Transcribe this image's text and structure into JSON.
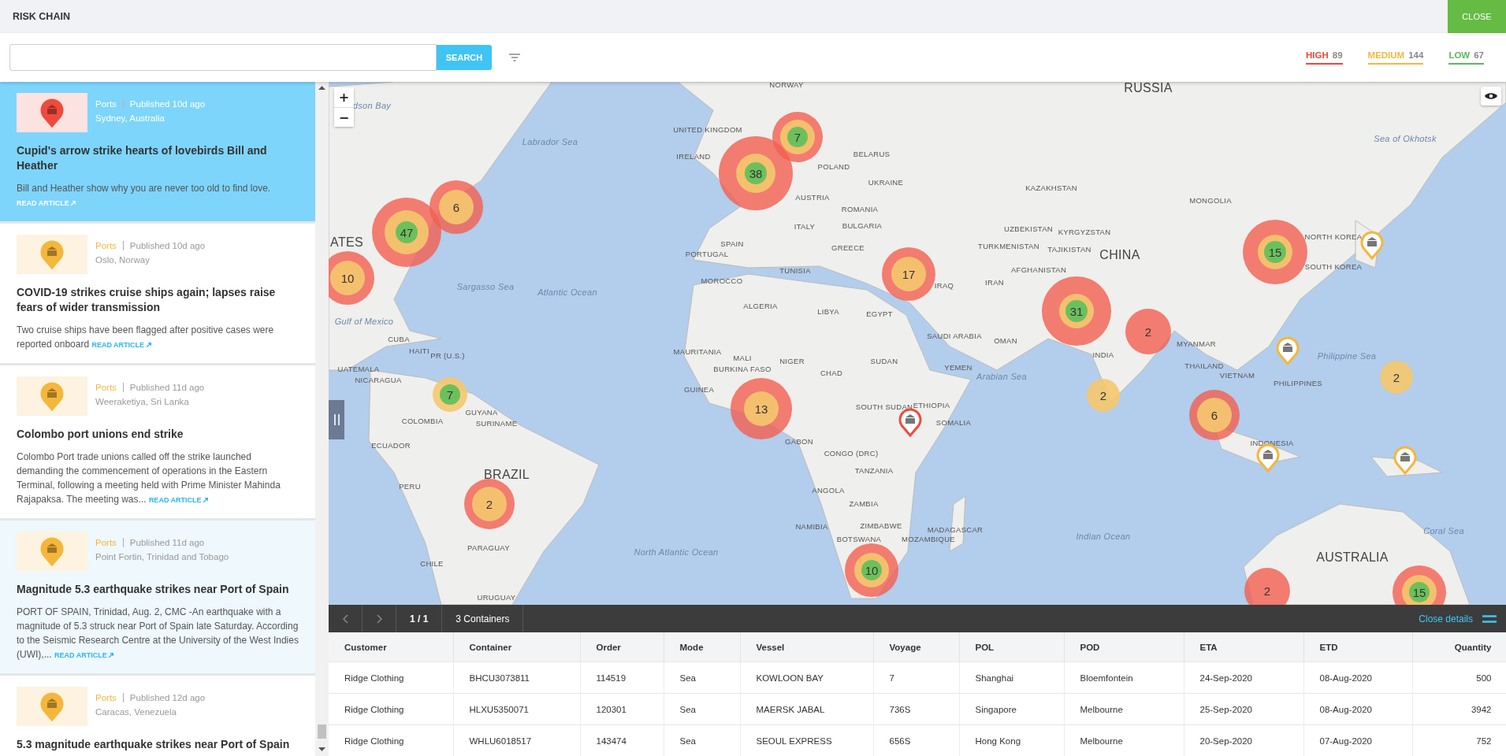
{
  "header": {
    "title": "RISK CHAIN",
    "close_button": "CLOSE"
  },
  "toolbar": {
    "search_button": "SEARCH"
  },
  "legend": [
    {
      "label": "HIGH",
      "count": "89",
      "color": "#f0453a"
    },
    {
      "label": "MEDIUM",
      "count": "144",
      "color": "#f5b73b"
    },
    {
      "label": "LOW",
      "count": "67",
      "color": "#5cb85c"
    }
  ],
  "articles": [
    {
      "color": "#ef4b3c",
      "category": "Ports",
      "published": "Published 10d ago",
      "location": "Sydney, Australia",
      "title": "Cupid's arrow strike hearts of lovebirds Bill and Heather",
      "summary": "Bill and Heather show why you are never too old to find love.",
      "link": "READ ARTICLE",
      "selected": true,
      "hovered": false
    },
    {
      "color": "#f5b73b",
      "category": "Ports",
      "published": "Published 10d ago",
      "location": "Oslo, Norway",
      "title": "COVID-19 strikes cruise ships again; lapses raise fears of wider transmission",
      "summary": "Two cruise ships have been flagged after positive cases were reported onboard",
      "link": "READ ARTICLE",
      "selected": false,
      "hovered": false
    },
    {
      "color": "#f5b73b",
      "category": "Ports",
      "published": "Published 11d ago",
      "location": "Weeraketiya, Sri Lanka",
      "title": "Colombo port unions end strike",
      "summary": "Colombo Port trade unions called off the strike launched demanding the commencement of operations in the Eastern Terminal, following a meeting held with Prime Minister Mahinda Rajapaksa. The meeting was...",
      "link": "READ ARTICLE",
      "selected": false,
      "hovered": false
    },
    {
      "color": "#f5b73b",
      "category": "Ports",
      "published": "Published 11d ago",
      "location": "Point Fortin, Trinidad and Tobago",
      "title": "Magnitude 5.3 earthquake strikes near Port of Spain",
      "summary": "PORT OF SPAIN, Trinidad, Aug. 2, CMC -An earthquake with a magnitude of 5.3 struck near Port of Spain late Saturday. According to the Seismic Research Centre at the University of the West Indies (UWI),...",
      "link": "READ ARTICLE",
      "selected": false,
      "hovered": true
    },
    {
      "color": "#f5b73b",
      "category": "Ports",
      "published": "Published 12d ago",
      "location": "Caracas, Venezuela",
      "title": "5.3 magnitude earthquake strikes near Port of Spain",
      "selected": false,
      "hovered": false
    }
  ],
  "map": {
    "zoom_in": "+",
    "zoom_out": "−",
    "labels": [
      {
        "text": "dson Bay",
        "kind": "sea"
      },
      {
        "text": "Labrador Sea",
        "kind": "sea"
      },
      {
        "text": "NORWAY",
        "kind": "country"
      },
      {
        "text": "UNITED KINGDOM",
        "kind": "country"
      },
      {
        "text": "IRELAND",
        "kind": "country"
      },
      {
        "text": "BELARUS",
        "kind": "country"
      },
      {
        "text": "POLAND",
        "kind": "country"
      },
      {
        "text": "UKRAINE",
        "kind": "country"
      },
      {
        "text": "AUSTRIA",
        "kind": "country"
      },
      {
        "text": "ROMANIA",
        "kind": "country"
      },
      {
        "text": "ITALY",
        "kind": "country"
      },
      {
        "text": "BULGARIA",
        "kind": "country"
      },
      {
        "text": "SPAIN",
        "kind": "country"
      },
      {
        "text": "PORTUGAL",
        "kind": "country"
      },
      {
        "text": "GREECE",
        "kind": "country"
      },
      {
        "text": "ATES",
        "kind": "major"
      },
      {
        "text": "TUNISIA",
        "kind": "country"
      },
      {
        "text": "MOROCCO",
        "kind": "country"
      },
      {
        "text": "ALGERIA",
        "kind": "country"
      },
      {
        "text": "LIBYA",
        "kind": "country"
      },
      {
        "text": "EGYPT",
        "kind": "country"
      },
      {
        "text": "MAURITANIA",
        "kind": "country"
      },
      {
        "text": "MALI",
        "kind": "country"
      },
      {
        "text": "NIGER",
        "kind": "country"
      },
      {
        "text": "SUDAN",
        "kind": "country"
      },
      {
        "text": "CHAD",
        "kind": "country"
      },
      {
        "text": "BURKINA FASO",
        "kind": "country"
      },
      {
        "text": "GUINEA",
        "kind": "country"
      },
      {
        "text": "SOUTH SUDAN",
        "kind": "country"
      },
      {
        "text": "GABON",
        "kind": "country"
      },
      {
        "text": "CONGO (DRC)",
        "kind": "country"
      },
      {
        "text": "TANZANIA",
        "kind": "country"
      },
      {
        "text": "ANGOLA",
        "kind": "country"
      },
      {
        "text": "ZAMBIA",
        "kind": "country"
      },
      {
        "text": "ZIMBABWE",
        "kind": "country"
      },
      {
        "text": "NAMIBIA",
        "kind": "country"
      },
      {
        "text": "BOTSWANA",
        "kind": "country"
      },
      {
        "text": "MOZAMBIQUE",
        "kind": "country"
      },
      {
        "text": "Atlantic Ocean",
        "kind": "sea"
      },
      {
        "text": "Sargasso Sea",
        "kind": "sea"
      },
      {
        "text": "Gulf of Mexico",
        "kind": "sea"
      },
      {
        "text": "CUBA",
        "kind": "country"
      },
      {
        "text": "HAITI",
        "kind": "country"
      },
      {
        "text": "PR (U.S.)",
        "kind": "country"
      },
      {
        "text": "UATEMALA",
        "kind": "country"
      },
      {
        "text": "NICARAGUA",
        "kind": "country"
      },
      {
        "text": "GUYANA",
        "kind": "country"
      },
      {
        "text": "SURINAME",
        "kind": "country"
      },
      {
        "text": "COLOMBIA",
        "kind": "country"
      },
      {
        "text": "ECUADOR",
        "kind": "country"
      },
      {
        "text": "BRAZIL",
        "kind": "major"
      },
      {
        "text": "PERU",
        "kind": "country"
      },
      {
        "text": "PARAGUAY",
        "kind": "country"
      },
      {
        "text": "CHILE",
        "kind": "country"
      },
      {
        "text": "URUGUAY",
        "kind": "country"
      },
      {
        "text": "North Atlantic Ocean",
        "kind": "sea"
      },
      {
        "text": "RUSSIA",
        "kind": "major"
      },
      {
        "text": "Sea of Okhotsk",
        "kind": "sea"
      },
      {
        "text": "KAZAKHSTAN",
        "kind": "country"
      },
      {
        "text": "MONGOLIA",
        "kind": "country"
      },
      {
        "text": "UZBEKISTAN",
        "kind": "country"
      },
      {
        "text": "KYRGYZSTAN",
        "kind": "country"
      },
      {
        "text": "TURKMENISTAN",
        "kind": "country"
      },
      {
        "text": "TAJIKISTAN",
        "kind": "country"
      },
      {
        "text": "CHINA",
        "kind": "major"
      },
      {
        "text": "NORTH KOREA",
        "kind": "country"
      },
      {
        "text": "SOUTH KOREA",
        "kind": "country"
      },
      {
        "text": "IRAQ",
        "kind": "country"
      },
      {
        "text": "IRAN",
        "kind": "country"
      },
      {
        "text": "AFGHANISTAN",
        "kind": "country"
      },
      {
        "text": "SAUDI ARABIA",
        "kind": "country"
      },
      {
        "text": "OMAN",
        "kind": "country"
      },
      {
        "text": "INDIA",
        "kind": "country"
      },
      {
        "text": "MYANMAR",
        "kind": "country"
      },
      {
        "text": "YEMEN",
        "kind": "country"
      },
      {
        "text": "Arabian Sea",
        "kind": "sea"
      },
      {
        "text": "THAILAND",
        "kind": "country"
      },
      {
        "text": "VIETNAM",
        "kind": "country"
      },
      {
        "text": "Philippine Sea",
        "kind": "sea"
      },
      {
        "text": "PHILIPPINES",
        "kind": "country"
      },
      {
        "text": "ETHIOPIA",
        "kind": "country"
      },
      {
        "text": "SOMALIA",
        "kind": "country"
      },
      {
        "text": "INDONESIA",
        "kind": "country"
      },
      {
        "text": "MADAGASCAR",
        "kind": "country"
      },
      {
        "text": "Indian Ocean",
        "kind": "sea"
      },
      {
        "text": "Coral Sea",
        "kind": "sea"
      },
      {
        "text": "AUSTRALIA",
        "kind": "major"
      }
    ],
    "clusters": [
      {
        "count": "7",
        "high": true,
        "medium": true,
        "low": true
      },
      {
        "count": "38",
        "high": true,
        "medium": true,
        "low": true
      },
      {
        "count": "6",
        "high": true,
        "medium": true,
        "low": false
      },
      {
        "count": "47",
        "high": true,
        "medium": true,
        "low": true
      },
      {
        "count": "15",
        "high": true,
        "medium": true,
        "low": true
      },
      {
        "count": "17",
        "high": true,
        "medium": true,
        "low": false
      },
      {
        "count": "10",
        "high": true,
        "medium": true,
        "low": false
      },
      {
        "count": "31",
        "high": true,
        "medium": true,
        "low": true
      },
      {
        "count": "2",
        "high": true,
        "medium": false,
        "low": false
      },
      {
        "count": "2",
        "high": false,
        "medium": true,
        "low": false
      },
      {
        "count": "7",
        "high": false,
        "medium": true,
        "low": true
      },
      {
        "count": "2",
        "high": false,
        "medium": true,
        "low": false
      },
      {
        "count": "13",
        "high": true,
        "medium": true,
        "low": false
      },
      {
        "count": "6",
        "high": true,
        "medium": true,
        "low": false
      },
      {
        "count": "2",
        "high": true,
        "medium": true,
        "low": false
      },
      {
        "count": "10",
        "high": true,
        "medium": true,
        "low": true
      },
      {
        "count": "2",
        "high": true,
        "medium": false,
        "low": false
      },
      {
        "count": "15",
        "high": true,
        "medium": true,
        "low": true
      }
    ],
    "pins": [
      {
        "color": "#f5b73b"
      },
      {
        "color": "#f5b73b"
      },
      {
        "color": "#f5b73b"
      },
      {
        "color": "#f5b73b"
      },
      {
        "color": "#ef4b3c"
      }
    ]
  },
  "details": {
    "page": "1 / 1",
    "count": "3 Containers",
    "close": "Close details",
    "columns": [
      "Customer",
      "Container",
      "Order",
      "Mode",
      "Vessel",
      "Voyage",
      "POL",
      "POD",
      "ETA",
      "ETD",
      "Quantity"
    ],
    "rows": [
      [
        "Ridge Clothing",
        "BHCU3073811",
        "114519",
        "Sea",
        "KOWLOON BAY",
        "7",
        "Shanghai",
        "Bloemfontein",
        "24-Sep-2020",
        "08-Aug-2020",
        "500"
      ],
      [
        "Ridge Clothing",
        "HLXU5350071",
        "120301",
        "Sea",
        "MAERSK JABAL",
        "736S",
        "Singapore",
        "Melbourne",
        "25-Sep-2020",
        "08-Aug-2020",
        "3942"
      ],
      [
        "Ridge Clothing",
        "WHLU6018517",
        "143474",
        "Sea",
        "SEOUL EXPRESS",
        "656S",
        "Hong Kong",
        "Melbourne",
        "20-Sep-2020",
        "07-Aug-2020",
        "752"
      ]
    ]
  }
}
